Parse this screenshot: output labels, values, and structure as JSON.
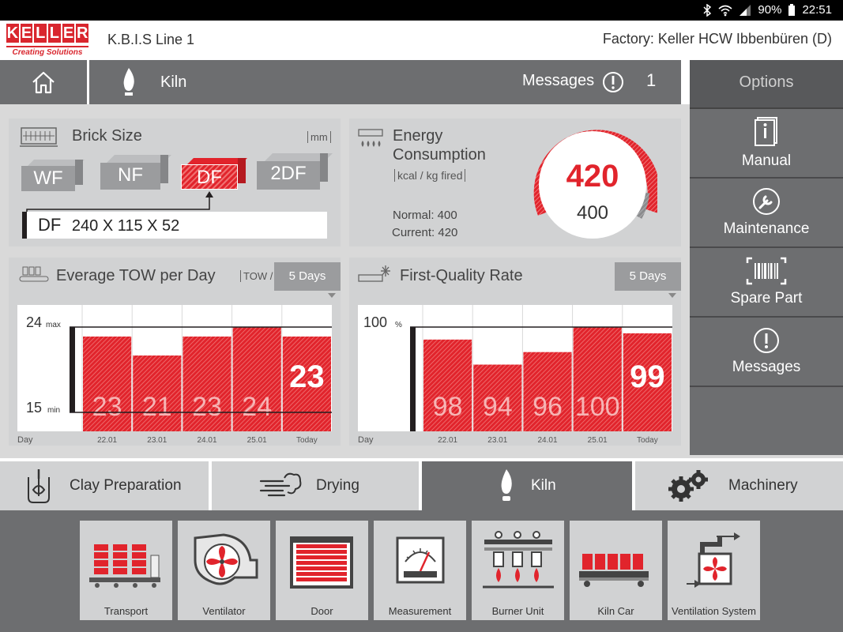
{
  "status_bar": {
    "battery": "90%",
    "time": "22:51",
    "icons": [
      "bluetooth-icon",
      "wifi-icon",
      "signal-icon",
      "battery-icon"
    ]
  },
  "header": {
    "logo": {
      "brand": "KELLER",
      "tagline": "Creating Solutions"
    },
    "line": "K.B.I.S Line 1",
    "factory": "Factory:  Keller HCW Ibbenbüren  (D)"
  },
  "nav": {
    "home_icon": "home-icon",
    "crumb_icon": "flame-icon",
    "crumb": "Kiln",
    "messages_label": "Messages",
    "messages_count": "1"
  },
  "sidebar": {
    "title": "Options",
    "items": [
      {
        "label": "Manual",
        "icon": "manual-icon"
      },
      {
        "label": "Maintenance",
        "icon": "wrench-icon"
      },
      {
        "label": "Spare Part",
        "icon": "barcode-icon"
      },
      {
        "label": "Messages",
        "icon": "alert-icon"
      }
    ]
  },
  "brick_size": {
    "title": "Brick Size",
    "unit": "mm",
    "options": [
      "WF",
      "NF",
      "DF",
      "2DF"
    ],
    "selected": "DF",
    "selected_code": "DF",
    "selected_dims": "240 X 115 X 52"
  },
  "energy": {
    "title_line1": "Energy",
    "title_line2": "Consumption",
    "unit": "kcal / kg fired",
    "normal_label": "Normal:  400",
    "current_label": "Current: 420",
    "current": "420",
    "normal": "400"
  },
  "tow": {
    "title": "Everage TOW per Day",
    "unit": "TOW /",
    "range_button": "5 Days",
    "max_label": "24",
    "max_suffix": "max",
    "min_label": "15",
    "min_suffix": "min",
    "x_axis_label": "Day"
  },
  "fq": {
    "title": "First-Quality Rate",
    "range_button": "5 Days",
    "top_label": "100",
    "top_suffix": "%",
    "x_axis_label": "Day"
  },
  "chart_data": [
    {
      "type": "bar",
      "title": "Everage TOW per Day",
      "categories": [
        "22.01",
        "23.01",
        "24.01",
        "25.01",
        "Today"
      ],
      "values": [
        23,
        21,
        23,
        24,
        23
      ],
      "ylim": [
        15,
        24
      ],
      "xlabel": "Day",
      "ylabel": "TOW /"
    },
    {
      "type": "bar",
      "title": "First-Quality Rate",
      "categories": [
        "22.01",
        "23.01",
        "24.01",
        "25.01",
        "Today"
      ],
      "values": [
        98,
        94,
        96,
        100,
        99
      ],
      "ylim": [
        0,
        100
      ],
      "xlabel": "Day",
      "ylabel": "%"
    }
  ],
  "categories": [
    {
      "label": "Clay Preparation",
      "icon": "mixer-icon",
      "active": false
    },
    {
      "label": "Drying",
      "icon": "wind-icon",
      "active": false
    },
    {
      "label": "Kiln",
      "icon": "flame-icon",
      "active": true
    },
    {
      "label": "Machinery",
      "icon": "gears-icon",
      "active": false
    }
  ],
  "tiles": [
    {
      "label": "Transport",
      "icon": "transport-icon"
    },
    {
      "label": "Ventilator",
      "icon": "ventilator-icon"
    },
    {
      "label": "Door",
      "icon": "door-icon"
    },
    {
      "label": "Measurement",
      "icon": "gauge-icon"
    },
    {
      "label": "Burner Unit",
      "icon": "burner-icon"
    },
    {
      "label": "Kiln Car",
      "icon": "kiln-car-icon"
    },
    {
      "label": "Ventilation System",
      "icon": "ventilation-icon"
    }
  ],
  "colors": {
    "accent": "#e1242c",
    "dark_gray": "#6d6e70",
    "panel": "#d1d2d3"
  }
}
